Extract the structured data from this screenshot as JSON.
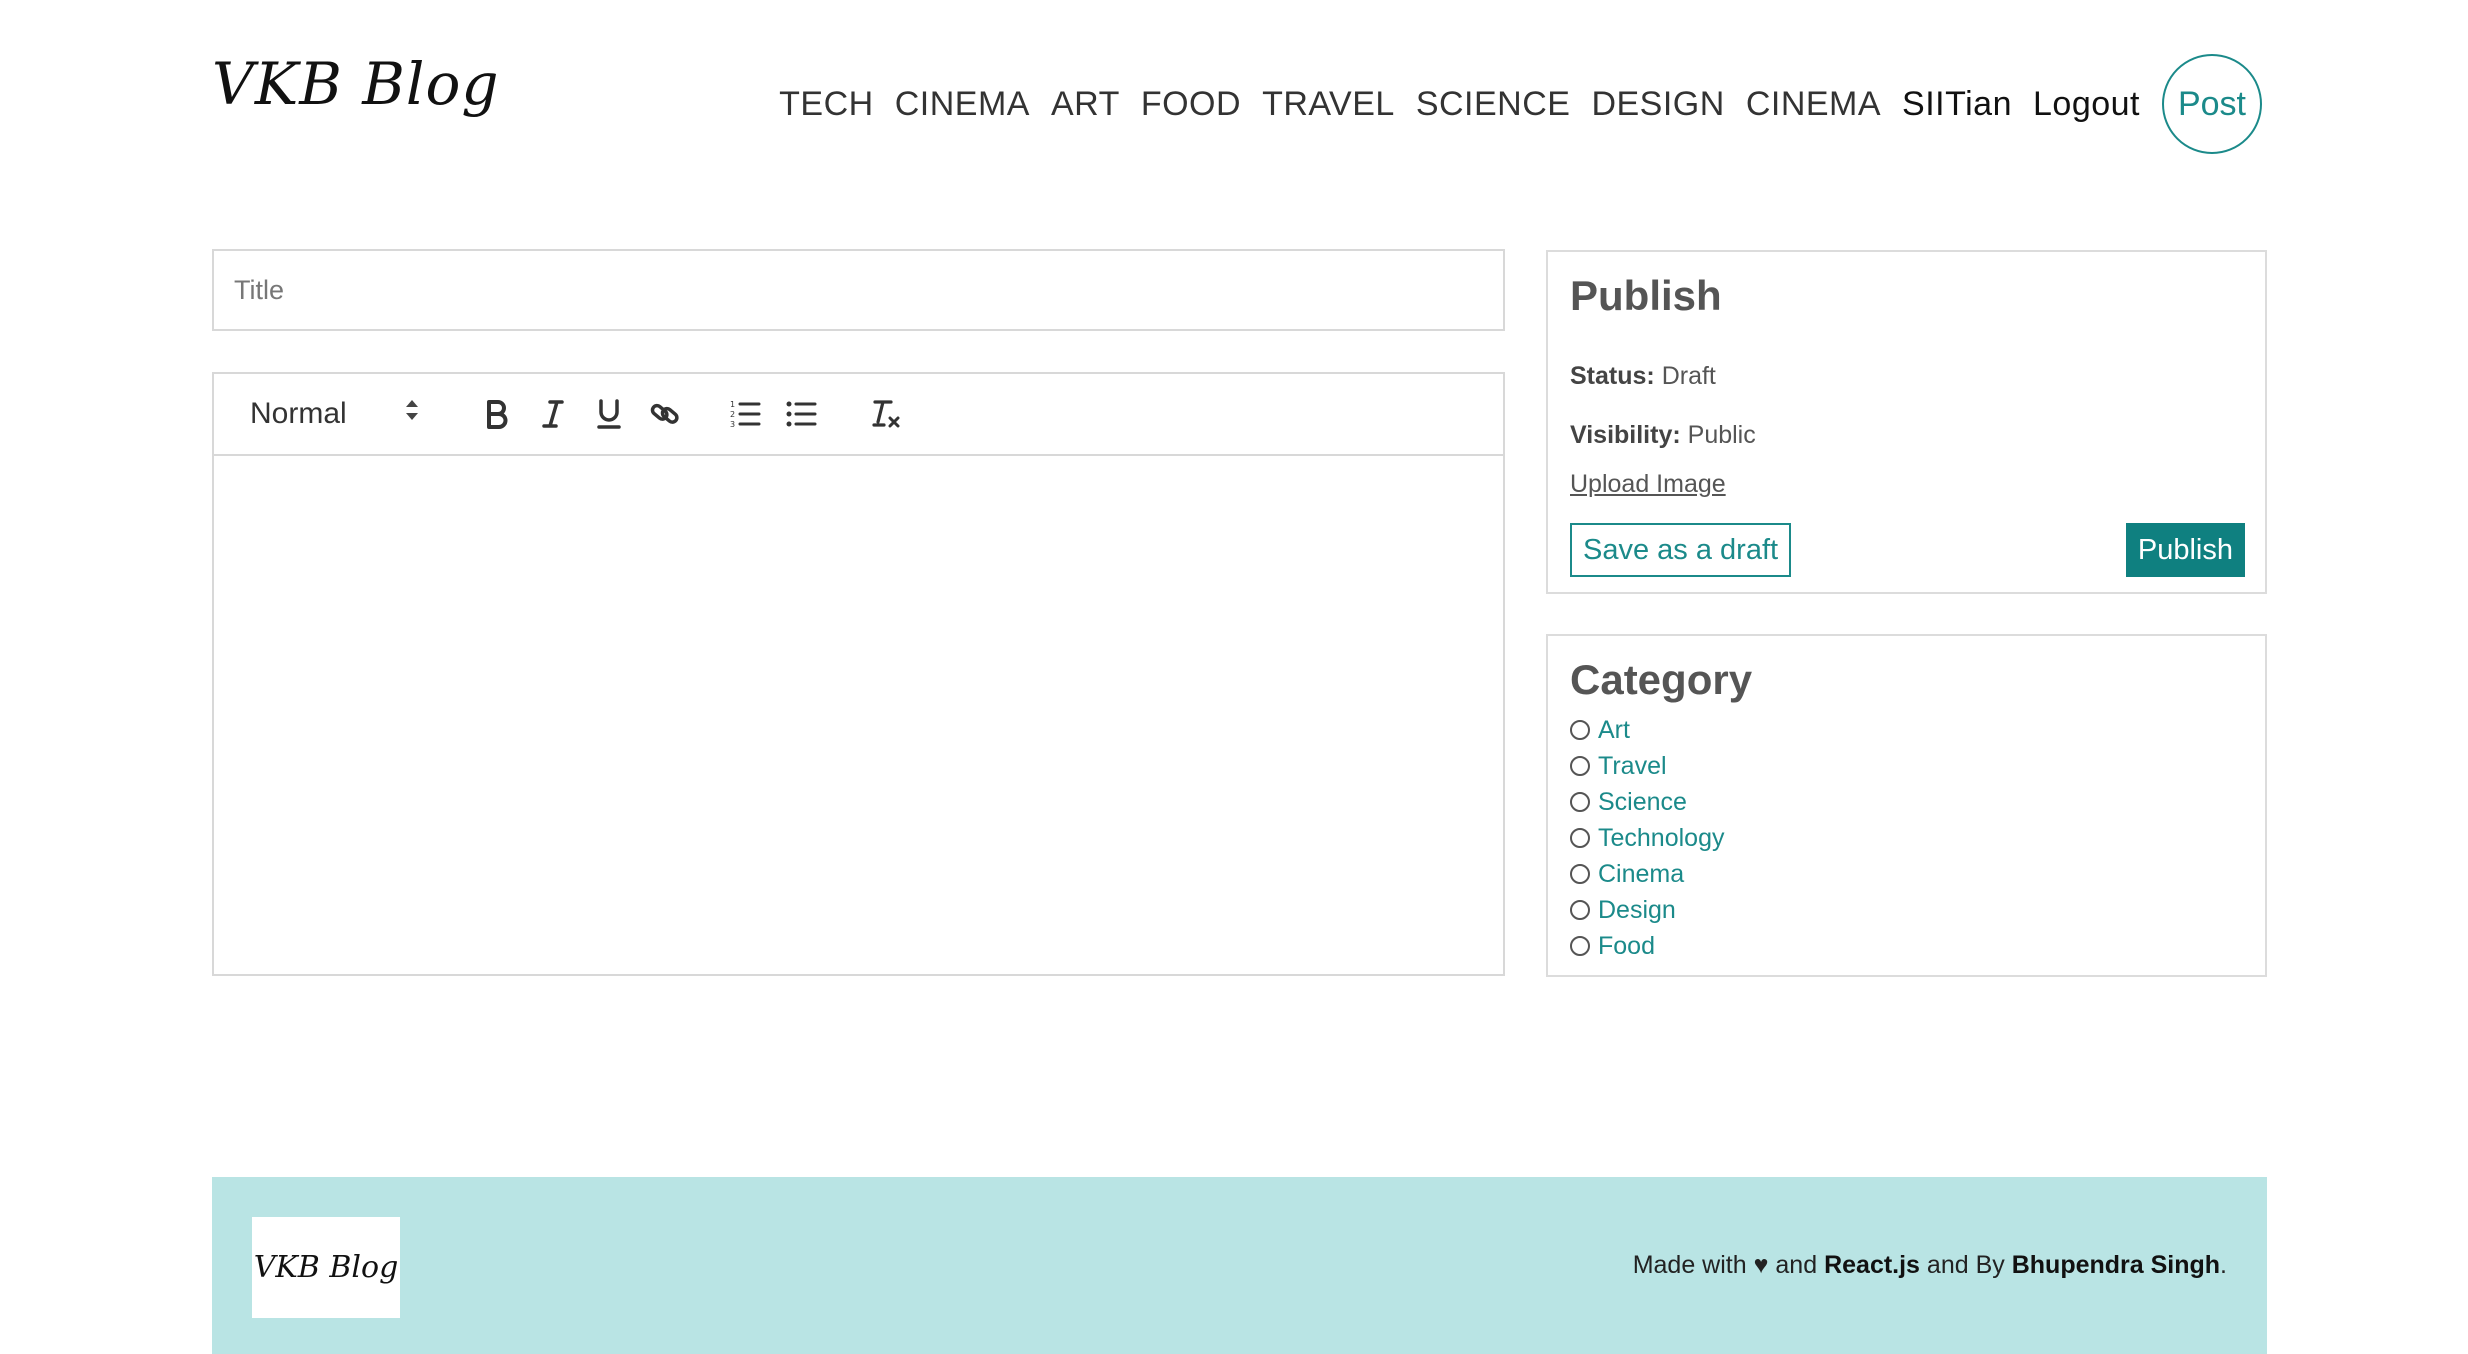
{
  "brand": {
    "logo_text": "VKB Blog"
  },
  "nav": {
    "links": [
      "TECH",
      "CINEMA",
      "ART",
      "FOOD",
      "TRAVEL",
      "SCIENCE",
      "DESIGN",
      "CINEMA"
    ],
    "user": "SIITian",
    "logout": "Logout",
    "post": "Post"
  },
  "editor": {
    "title_placeholder": "Title",
    "header_select": "Normal",
    "toolbar_icons": [
      "bold-icon",
      "italic-icon",
      "underline-icon",
      "link-icon",
      "ordered-list-icon",
      "bullet-list-icon",
      "clear-format-icon"
    ]
  },
  "publish": {
    "heading": "Publish",
    "status_label": "Status:",
    "status_value": "Draft",
    "visibility_label": "Visibility:",
    "visibility_value": "Public",
    "upload_label": "Upload Image",
    "save_draft_label": "Save as a draft",
    "publish_label": "Publish"
  },
  "category": {
    "heading": "Category",
    "items": [
      "Art",
      "Travel",
      "Science",
      "Technology",
      "Cinema",
      "Design",
      "Food"
    ]
  },
  "footer": {
    "logo_text": "VKB Blog",
    "made_with": "Made with",
    "heart": "♥",
    "and1": "and",
    "tech": "React.js",
    "and_by": "and By",
    "author": "Bhupendra Singh",
    "period": "."
  },
  "colors": {
    "accent": "#1b8a8a",
    "publish_bg": "#0f8080",
    "footer_bg": "#b9e4e4"
  }
}
